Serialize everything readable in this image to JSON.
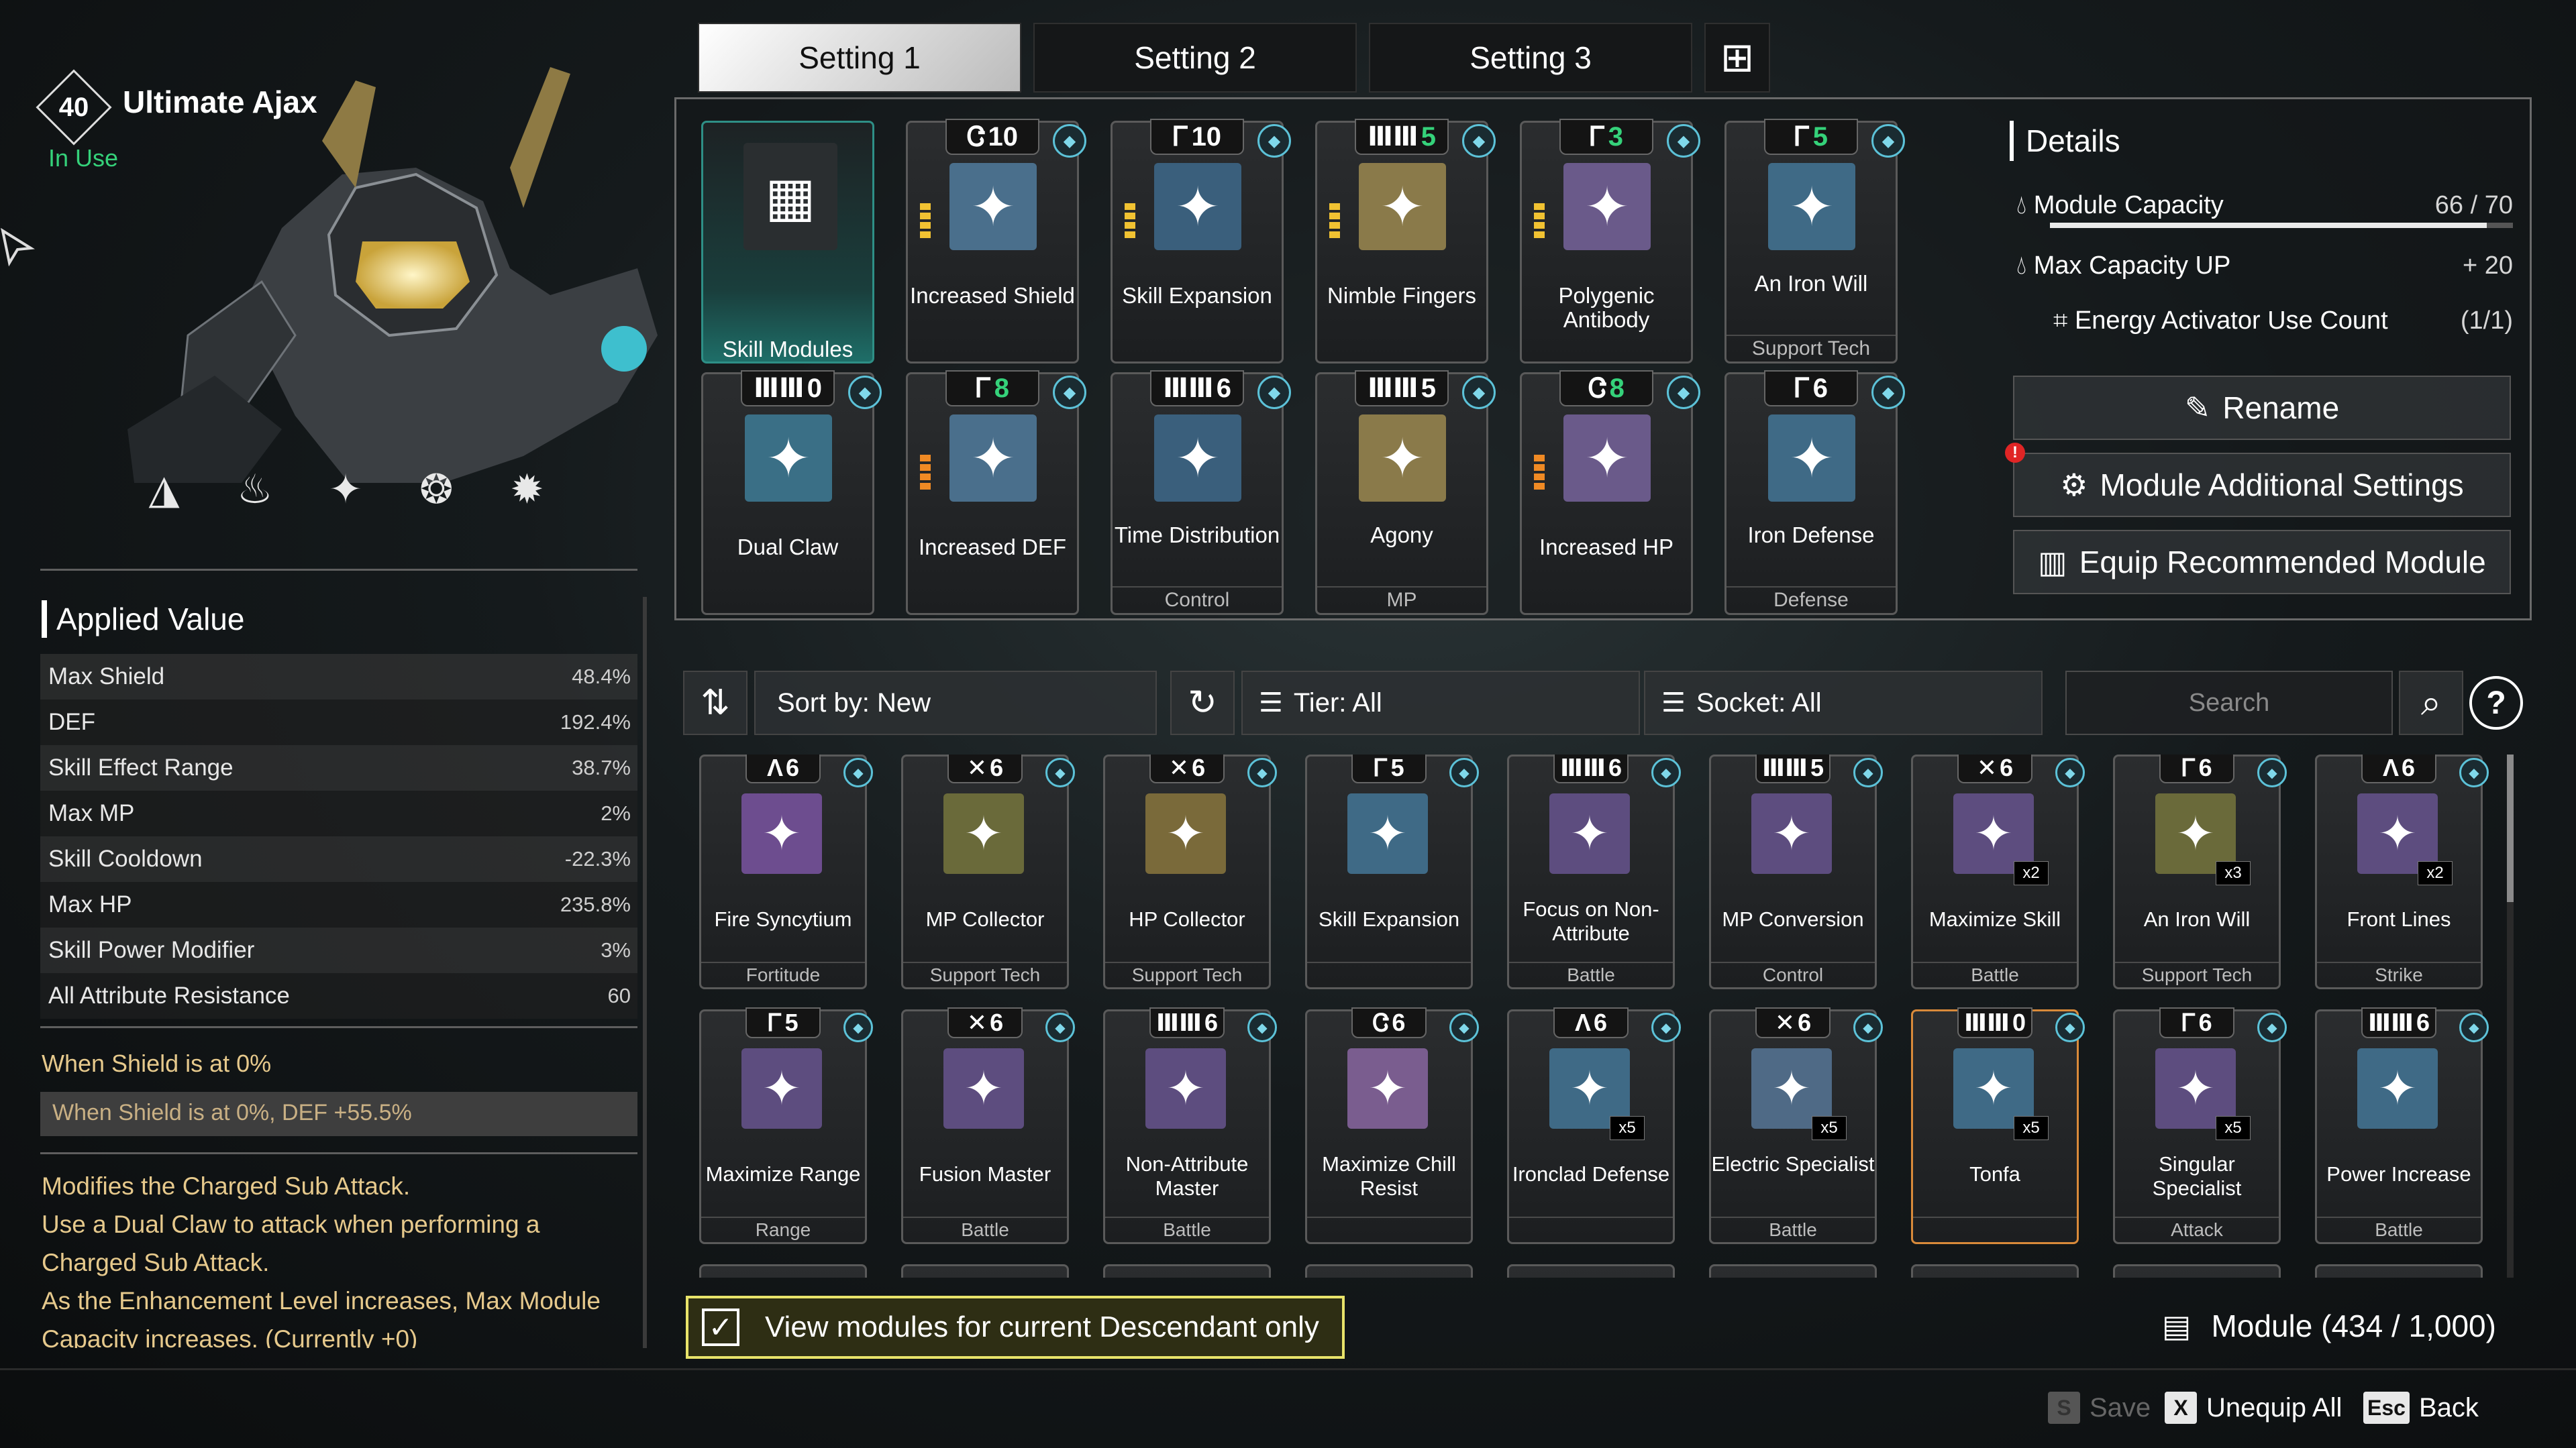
{
  "descendant": {
    "level": "40",
    "name": "Ultimate Ajax",
    "status": "In Use"
  },
  "tabs": [
    "Setting 1",
    "Setting 2",
    "Setting 3"
  ],
  "applied_value": {
    "title": "Applied Value",
    "stats": [
      {
        "label": "Max Shield",
        "value": "48.4%"
      },
      {
        "label": "DEF",
        "value": "192.4%"
      },
      {
        "label": "Skill Effect Range",
        "value": "38.7%"
      },
      {
        "label": "Max MP",
        "value": "2%"
      },
      {
        "label": "Skill Cooldown",
        "value": "-22.3%"
      },
      {
        "label": "Max HP",
        "value": "235.8%"
      },
      {
        "label": "Skill Power Modifier",
        "value": "3%"
      },
      {
        "label": "All Attribute Resistance",
        "value": "60"
      }
    ],
    "condition_title": "When Shield is at 0%",
    "condition_value": "When Shield is at 0%, DEF +55.5%",
    "description": [
      "Modifies the Charged Sub Attack.",
      "Use a Dual Claw to attack when performing a",
      "Charged Sub Attack.",
      "As the Enhancement Level increases, Max Module",
      "Capacity increases. (Currently +0)"
    ]
  },
  "equipped": [
    {
      "name": "Skill Modules",
      "socket": "",
      "cost": "",
      "category": ""
    },
    {
      "name": "Increased Shield",
      "socket": "Ꮳ",
      "cost": "10",
      "category": ""
    },
    {
      "name": "Skill Expansion",
      "socket": "Ꮁ",
      "cost": "10",
      "category": ""
    },
    {
      "name": "Nimble Fingers",
      "socket": "ⅢⅢ",
      "cost": "5",
      "category": ""
    },
    {
      "name": "Polygenic Antibody",
      "socket": "Ꮁ",
      "cost": "3",
      "category": ""
    },
    {
      "name": "An Iron Will",
      "socket": "Ꮁ",
      "cost": "5",
      "category": "Support Tech"
    },
    {
      "name": "Dual Claw",
      "socket": "ⅢⅢ",
      "cost": "0",
      "category": ""
    },
    {
      "name": "Increased DEF",
      "socket": "Ꮁ",
      "cost": "8",
      "category": ""
    },
    {
      "name": "Time Distribution",
      "socket": "ⅢⅢ",
      "cost": "6",
      "category": "Control"
    },
    {
      "name": "Agony",
      "socket": "ⅢⅢ",
      "cost": "5",
      "category": "MP"
    },
    {
      "name": "Increased HP",
      "socket": "Ꮳ",
      "cost": "8",
      "category": ""
    },
    {
      "name": "Iron Defense",
      "socket": "Ꮁ",
      "cost": "6",
      "category": "Defense"
    }
  ],
  "details": {
    "title": "Details",
    "capacity_label": "Module Capacity",
    "capacity_value": "66 / 70",
    "capacity_fraction": 0.943,
    "max_capacity_label": "Max Capacity UP",
    "max_capacity_value": "+ 20",
    "energy_label": "Energy Activator Use Count",
    "energy_value": "(1/1)",
    "rename": "Rename",
    "additional": "Module Additional Settings",
    "recommend": "Equip Recommended Module"
  },
  "filters": {
    "sort": "Sort by: New",
    "tier": "Tier: All",
    "socket": "Socket: All",
    "search_placeholder": "Search"
  },
  "inventory": [
    {
      "name": "Fire Syncytium",
      "socket": "Λ",
      "cost": "6",
      "category": "Fortitude",
      "mult": ""
    },
    {
      "name": "MP Collector",
      "socket": "✕",
      "cost": "6",
      "category": "Support Tech",
      "mult": ""
    },
    {
      "name": "HP Collector",
      "socket": "✕",
      "cost": "6",
      "category": "Support Tech",
      "mult": ""
    },
    {
      "name": "Skill Expansion",
      "socket": "Ꮁ",
      "cost": "5",
      "category": "",
      "mult": ""
    },
    {
      "name": "Focus on Non-Attribute",
      "socket": "ⅢⅢ",
      "cost": "6",
      "category": "Battle",
      "mult": ""
    },
    {
      "name": "MP Conversion",
      "socket": "ⅢⅢ",
      "cost": "5",
      "category": "Control",
      "mult": ""
    },
    {
      "name": "Maximize Skill",
      "socket": "✕",
      "cost": "6",
      "category": "Battle",
      "mult": "x2"
    },
    {
      "name": "An Iron Will",
      "socket": "Ꮁ",
      "cost": "6",
      "category": "Support Tech",
      "mult": "x3"
    },
    {
      "name": "Front Lines",
      "socket": "Λ",
      "cost": "6",
      "category": "Strike",
      "mult": "x2"
    },
    {
      "name": "Maximize Range",
      "socket": "Ꮁ",
      "cost": "5",
      "category": "Range",
      "mult": ""
    },
    {
      "name": "Fusion Master",
      "socket": "✕",
      "cost": "6",
      "category": "Battle",
      "mult": ""
    },
    {
      "name": "Non-Attribute Master",
      "socket": "ⅢⅢ",
      "cost": "6",
      "category": "Battle",
      "mult": ""
    },
    {
      "name": "Maximize Chill Resist",
      "socket": "Ꮳ",
      "cost": "6",
      "category": "",
      "mult": ""
    },
    {
      "name": "Ironclad Defense",
      "socket": "Λ",
      "cost": "6",
      "category": "",
      "mult": "x5"
    },
    {
      "name": "Electric Specialist",
      "socket": "✕",
      "cost": "6",
      "category": "Battle",
      "mult": "x5"
    },
    {
      "name": "Tonfa",
      "socket": "ⅢⅢ",
      "cost": "0",
      "category": "",
      "mult": "x5"
    },
    {
      "name": "Singular Specialist",
      "socket": "Ꮁ",
      "cost": "6",
      "category": "Attack",
      "mult": "x5"
    },
    {
      "name": "Power Increase",
      "socket": "ⅢⅢ",
      "cost": "6",
      "category": "Battle",
      "mult": ""
    }
  ],
  "view_toggle": "View modules for current Descendant only",
  "module_count": "Module (434 / 1,000)",
  "footer": [
    {
      "key": "S",
      "label": "Save"
    },
    {
      "key": "X",
      "label": "Unequip All"
    },
    {
      "key": "Esc",
      "label": "Back"
    }
  ]
}
